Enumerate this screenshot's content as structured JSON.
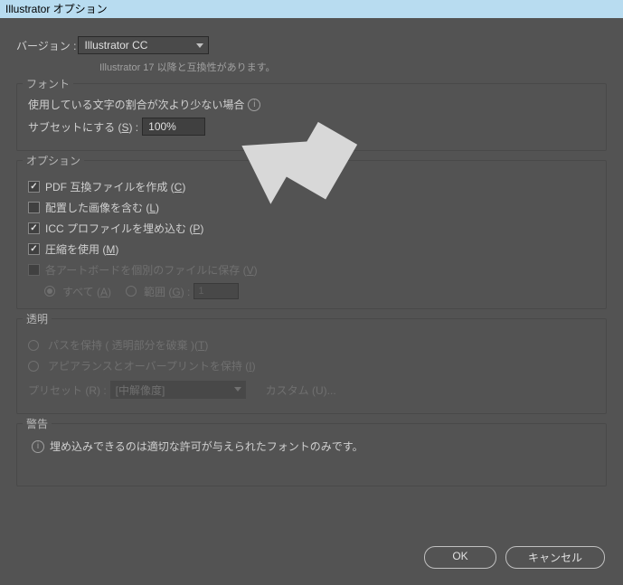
{
  "titlebar": "Illustrator オプション",
  "version": {
    "label": "バージョン :",
    "value": "Illustrator CC",
    "note": "Illustrator 17 以降と互換性があります。"
  },
  "font": {
    "title": "フォント",
    "subset_label_pre": "使用している文字の割合が次より少ない場合",
    "subset_label": "サブセットにする (",
    "subset_key": "S",
    "subset_label_post": ") :",
    "subset_value": "100%"
  },
  "options": {
    "title": "オプション",
    "pdf": {
      "label": "PDF 互換ファイルを作成 (",
      "key": "C",
      "post": ")",
      "checked": true
    },
    "embed_images": {
      "label": "配置した画像を含む (",
      "key": "L",
      "post": ")",
      "checked": false
    },
    "icc": {
      "label": "ICC プロファイルを埋め込む (",
      "key": "P",
      "post": ")",
      "checked": true
    },
    "compress": {
      "label": "圧縮を使用 (",
      "key": "M",
      "post": ")",
      "checked": true
    },
    "artboard": {
      "label": "各アートボードを個別のファイルに保存 (",
      "key": "V",
      "post": ")",
      "checked": false
    },
    "range": {
      "all": {
        "label": "すべて (",
        "key": "A",
        "post": ")"
      },
      "range": {
        "label": "範囲 (",
        "key": "G",
        "post": ") :"
      },
      "value": "1"
    }
  },
  "transparency": {
    "title": "透明",
    "preserve_paths": {
      "label": "パスを保持 ( 透明部分を破棄 )(",
      "key": "T",
      "post": ")"
    },
    "preserve_appearance": {
      "label": "アピアランスとオーバープリントを保持 (",
      "key": "I",
      "post": ")"
    },
    "preset_label": "プリセット (R) :",
    "preset_value": "[中解像度]",
    "custom": "カスタム (U)..."
  },
  "warning": {
    "title": "警告",
    "text": "埋め込みできるのは適切な許可が与えられたフォントのみです。"
  },
  "buttons": {
    "ok": "OK",
    "cancel": "キャンセル"
  }
}
